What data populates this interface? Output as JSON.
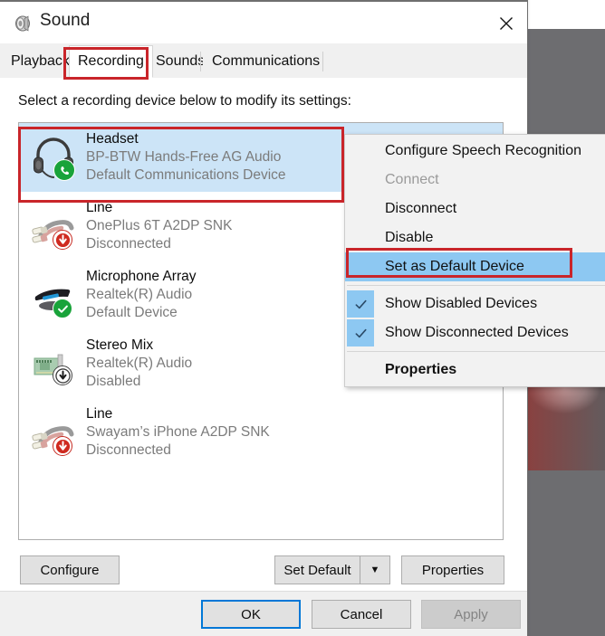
{
  "window": {
    "title": "Sound",
    "icon": "speaker-icon",
    "close_label": "✕"
  },
  "tabs": [
    {
      "label": "Playback",
      "active": false
    },
    {
      "label": "Recording",
      "active": true
    },
    {
      "label": "Sounds",
      "active": false
    },
    {
      "label": "Communications",
      "active": false
    }
  ],
  "panel": {
    "prompt": "Select a recording device below to modify its settings:"
  },
  "devices": [
    {
      "name": "Headset",
      "subtitle": "BP-BTW Hands-Free AG Audio",
      "status": "Default Communications Device",
      "icon": "headset-icon",
      "badge": "green-phone",
      "selected": true
    },
    {
      "name": "Line",
      "subtitle": "OnePlus 6T A2DP SNK",
      "status": "Disconnected",
      "icon": "rca-cable-icon",
      "badge": "red-down-arrow",
      "selected": false
    },
    {
      "name": "Microphone Array",
      "subtitle": "Realtek(R) Audio",
      "status": "Default Device",
      "icon": "microphone-array-icon",
      "badge": "green-check",
      "selected": false
    },
    {
      "name": "Stereo Mix",
      "subtitle": "Realtek(R) Audio",
      "status": "Disabled",
      "icon": "sound-card-icon",
      "badge": "gray-down-arrow",
      "selected": false
    },
    {
      "name": "Line",
      "subtitle": "Swayam’s iPhone A2DP SNK",
      "status": "Disconnected",
      "icon": "rca-cable-icon",
      "badge": "red-down-arrow",
      "selected": false
    }
  ],
  "actions": {
    "configure": "Configure",
    "set_default": "Set Default",
    "set_default_arrow": "▼",
    "properties": "Properties"
  },
  "footer": {
    "ok": "OK",
    "cancel": "Cancel",
    "apply": "Apply"
  },
  "context_menu": {
    "items": [
      {
        "label": "Configure Speech Recognition",
        "state": "normal"
      },
      {
        "label": "Connect",
        "state": "disabled"
      },
      {
        "label": "Disconnect",
        "state": "normal"
      },
      {
        "label": "Disable",
        "state": "normal"
      },
      {
        "label": "Set as Default Device",
        "state": "highlighted"
      }
    ],
    "checked_items": [
      {
        "label": "Show Disabled Devices",
        "check": "✓"
      },
      {
        "label": "Show Disconnected Devices",
        "check": "✓"
      }
    ],
    "properties": {
      "label": "Properties",
      "state": "bold"
    }
  },
  "colors": {
    "annotation_red": "#c9252a",
    "selection_blue": "#cce4f7",
    "menu_highlight": "#8dc8f2",
    "default_button_outline": "#0078d7",
    "status_green": "#19a33a",
    "status_red": "#c62b22"
  }
}
